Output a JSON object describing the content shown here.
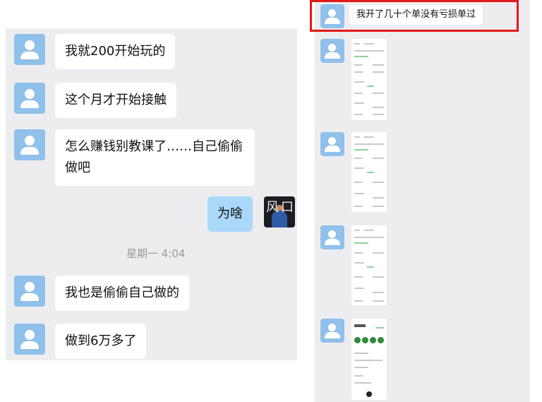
{
  "left_chat": {
    "messages": [
      {
        "text": "我就200开始玩的"
      },
      {
        "text": "这个月才开始接触"
      },
      {
        "text": "怎么赚钱别教课了……自己偷偷做吧"
      },
      {
        "text": "为啥"
      },
      {
        "text": "我也是偷偷自己做的"
      },
      {
        "text": "做到6万多了"
      }
    ],
    "timestamp": "星期一 4:04",
    "self_avatar_glyphs": [
      "风",
      "口"
    ]
  },
  "right_chat": {
    "highlighted_message": "我开了几十个单没有亏损单过",
    "highlight_color": "#e11919",
    "thumbnails": [
      "screenshot-thumbnail",
      "screenshot-thumbnail",
      "screenshot-thumbnail",
      "screenshot-thumbnail"
    ]
  },
  "colors": {
    "panel_bg": "#ededf0",
    "avatar": "#8fc1ea",
    "my_bubble": "#a9d8f8"
  }
}
